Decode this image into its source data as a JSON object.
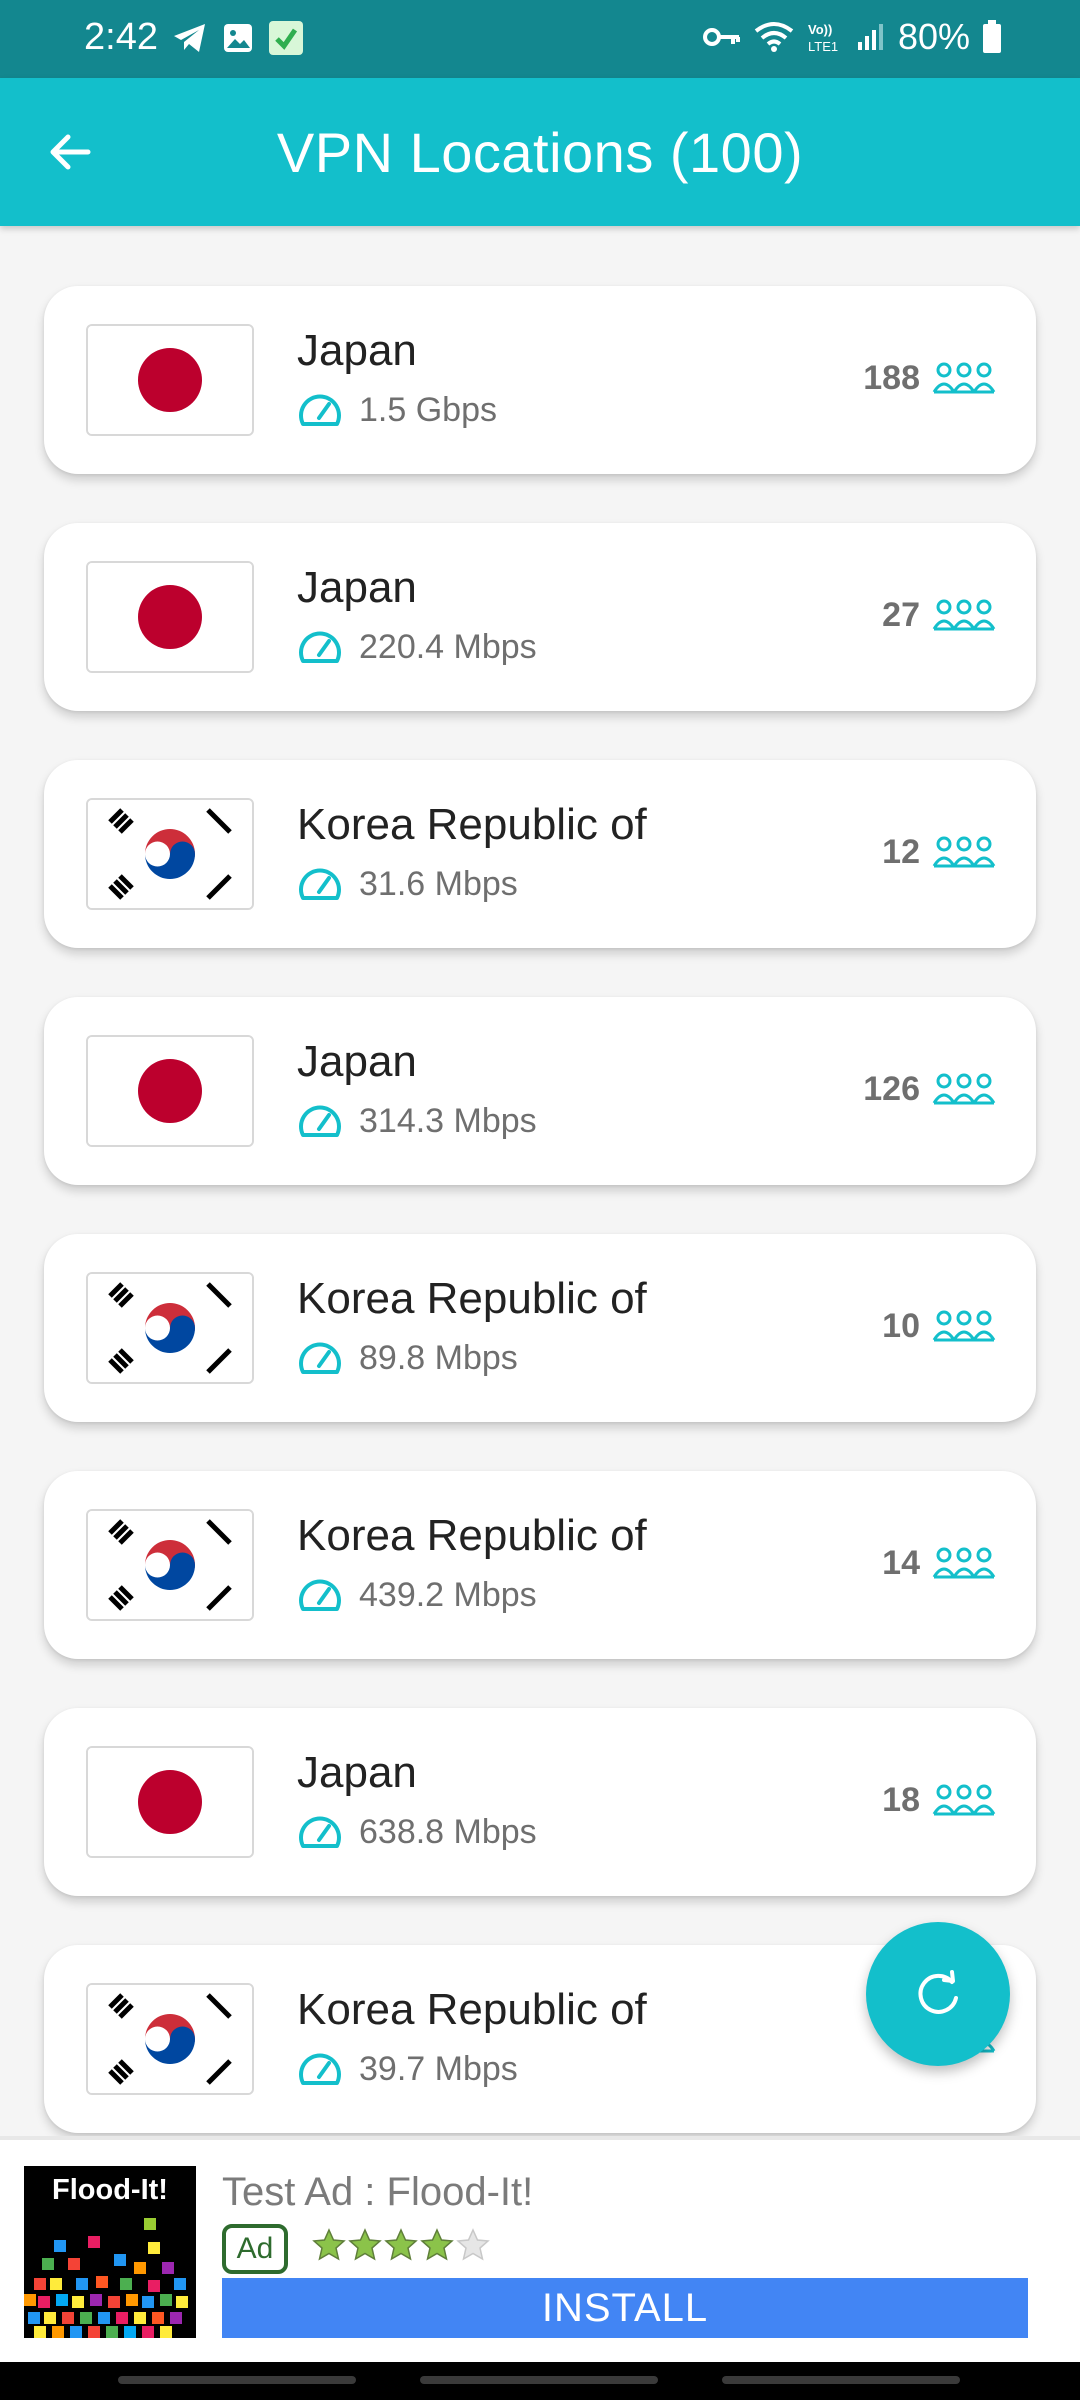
{
  "status_bar": {
    "time": "2:42",
    "battery": "80%",
    "icons": [
      "telegram-icon",
      "gallery-icon",
      "app-notification-icon",
      "vpn-key-icon",
      "wifi-icon",
      "volte-icon",
      "signal-icon",
      "battery-icon"
    ]
  },
  "app_bar": {
    "title": "VPN Locations (100)",
    "back_icon": "arrow-left-icon"
  },
  "servers": [
    {
      "country": "Japan",
      "flag": "japan",
      "speed": "1.5 Gbps",
      "users": "188"
    },
    {
      "country": "Japan",
      "flag": "japan",
      "speed": "220.4 Mbps",
      "users": "27"
    },
    {
      "country": "Korea Republic of",
      "flag": "korea",
      "speed": "31.6 Mbps",
      "users": "12"
    },
    {
      "country": "Japan",
      "flag": "japan",
      "speed": "314.3 Mbps",
      "users": "126"
    },
    {
      "country": "Korea Republic of",
      "flag": "korea",
      "speed": "89.8 Mbps",
      "users": "10"
    },
    {
      "country": "Korea Republic of",
      "flag": "korea",
      "speed": "439.2 Mbps",
      "users": "14"
    },
    {
      "country": "Japan",
      "flag": "japan",
      "speed": "638.8 Mbps",
      "users": "18"
    },
    {
      "country": "Korea Republic of",
      "flag": "korea",
      "speed": "39.7 Mbps",
      "users": ""
    }
  ],
  "fab": {
    "icon": "refresh-icon"
  },
  "ad": {
    "thumb_title": "Flood-It!",
    "title": "Test Ad : Flood-It!",
    "badge": "Ad",
    "rating": 4,
    "install_label": "INSTALL"
  },
  "colors": {
    "status_bar": "#13878f",
    "app_bar": "#13bfcb",
    "accent": "#13bfcb",
    "install_button": "#4285f4"
  }
}
